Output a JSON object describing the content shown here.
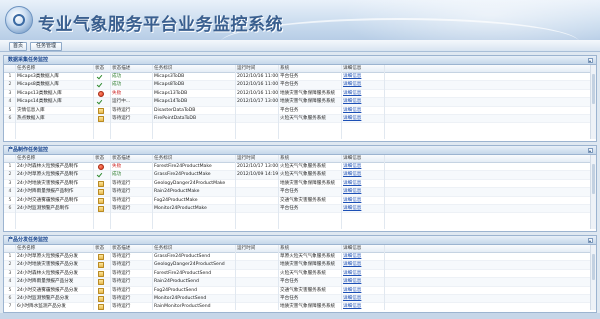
{
  "app": {
    "title": "专业气象服务平台业务监控系统"
  },
  "toolbar": {
    "home_label": "首页",
    "task_label": "任务管理"
  },
  "columns": {
    "name": "任务名称",
    "icon": "状态",
    "status": "状态描述",
    "id": "任务标识",
    "time": "运行时间",
    "system": "系统",
    "detail": "详细信息"
  },
  "panels": [
    {
      "title": "数据采集任务监控",
      "rows": [
        {
          "idx": "1",
          "name": "Micaps3类数据入库",
          "icon": "check-icon",
          "status": "成功",
          "status_type": "ok",
          "id": "Micaps3ToDB",
          "time": "2012/10/16 11:00",
          "system": "平台任务",
          "link": "详细信息"
        },
        {
          "idx": "2",
          "name": "Micaps8类数据入库",
          "icon": "check-icon",
          "status": "成功",
          "status_type": "ok",
          "id": "Micaps8ToDB",
          "time": "2012/10/16 11:00",
          "system": "平台任务",
          "link": "详细信息"
        },
        {
          "idx": "3",
          "name": "Micaps13类数据入库",
          "icon": "error-icon",
          "status": "失败",
          "status_type": "fail",
          "id": "Micaps13ToDB",
          "time": "2012/10/16 11:00",
          "system": "地质灾害气象保障服务系统",
          "link": "详细信息"
        },
        {
          "idx": "4",
          "name": "Micaps14类数据入库",
          "icon": "check-icon",
          "status": "运行中...",
          "status_type": "run",
          "id": "Micaps14ToDB",
          "time": "2012/10/17 13:00",
          "system": "地质灾害气象保障服务系统",
          "link": "详细信息"
        },
        {
          "idx": "5",
          "name": "灾情信息入库",
          "icon": "folder-icon",
          "status": "等待运行",
          "status_type": "run",
          "id": "DisasterDataToDB",
          "time": "",
          "system": "平台任务",
          "link": "详细信息"
        },
        {
          "idx": "6",
          "name": "热点数据入库",
          "icon": "folder-icon",
          "status": "等待运行",
          "status_type": "run",
          "id": "FirePointDataToDB",
          "time": "",
          "system": "火险天气气象服务系统",
          "link": "详细信息"
        }
      ]
    },
    {
      "title": "产品制作任务监控",
      "rows": [
        {
          "idx": "1",
          "name": "24小时森林火险预报产品制作",
          "icon": "error-icon",
          "status": "失败",
          "status_type": "fail",
          "id": "ForestFire24ProductMake",
          "time": "2012/10/17 13:00",
          "system": "火险天气气象服务系统",
          "link": "详细信息"
        },
        {
          "idx": "2",
          "name": "24小时草原火险预报产品制作",
          "icon": "check-icon",
          "status": "成功",
          "status_type": "ok",
          "id": "GrassFire24ProductMake",
          "time": "2012/10/09 14:19",
          "system": "火险天气气象服务系统",
          "link": "详细信息"
        },
        {
          "idx": "3",
          "name": "24小时地质灾害预报产品制作",
          "icon": "folder-icon",
          "status": "等待运行",
          "status_type": "run",
          "id": "GeologyDanger24ProductMake",
          "time": "",
          "system": "地质灾害气象保障服务系统",
          "link": "详细信息"
        },
        {
          "idx": "4",
          "name": "24小时降雨量预报产品制作",
          "icon": "folder-icon",
          "status": "等待运行",
          "status_type": "run",
          "id": "Rain24ProductMake",
          "time": "",
          "system": "平台任务",
          "link": "详细信息"
        },
        {
          "idx": "5",
          "name": "24小时交通雾霾预报产品制作",
          "icon": "folder-icon",
          "status": "等待运行",
          "status_type": "run",
          "id": "Fog24ProductMake",
          "time": "",
          "system": "交通气象灾害服务系统",
          "link": "详细信息"
        },
        {
          "idx": "6",
          "name": "24小时监测预警产品制作",
          "icon": "folder-icon",
          "status": "等待运行",
          "status_type": "run",
          "id": "Monitor24ProductMake",
          "time": "",
          "system": "平台任务",
          "link": "详细信息"
        }
      ]
    },
    {
      "title": "产品分发任务监控",
      "rows": [
        {
          "idx": "1",
          "name": "24小时草原火险预报产品分发",
          "icon": "folder-icon",
          "status": "等待运行",
          "status_type": "run",
          "id": "GrassFire24ProductSend",
          "time": "",
          "system": "草原火险天气气象服务系统",
          "link": "详细信息"
        },
        {
          "idx": "2",
          "name": "24小时地质灾害预报产品分发",
          "icon": "folder-icon",
          "status": "等待运行",
          "status_type": "run",
          "id": "GeologyDanger24ProductSend",
          "time": "",
          "system": "地质灾害气象保障服务系统",
          "link": "详细信息"
        },
        {
          "idx": "3",
          "name": "24小时森林火险预报产品分发",
          "icon": "folder-icon",
          "status": "等待运行",
          "status_type": "run",
          "id": "ForestFire24ProductSend",
          "time": "",
          "system": "火险天气气象服务系统",
          "link": "详细信息"
        },
        {
          "idx": "4",
          "name": "24小时降雨量预报产品分发",
          "icon": "folder-icon",
          "status": "等待运行",
          "status_type": "run",
          "id": "Rain24ProductSend",
          "time": "",
          "system": "平台任务",
          "link": "详细信息"
        },
        {
          "idx": "5",
          "name": "24小时交通雾霾预报产品分发",
          "icon": "folder-icon",
          "status": "等待运行",
          "status_type": "run",
          "id": "Fog24ProductSend",
          "time": "",
          "system": "交通气象灾害服务系统",
          "link": "详细信息"
        },
        {
          "idx": "6",
          "name": "24小时监测预警产品分发",
          "icon": "folder-icon",
          "status": "等待运行",
          "status_type": "run",
          "id": "Monitor24ProductSend",
          "time": "",
          "system": "平台任务",
          "link": "详细信息"
        },
        {
          "idx": "7",
          "name": "6小时降水监测产品分发",
          "icon": "folder-icon",
          "status": "等待运行",
          "status_type": "run",
          "id": "RainMonitorProductSend",
          "time": "",
          "system": "地质灾害气象保障服务系统",
          "link": "详细信息"
        }
      ]
    }
  ]
}
